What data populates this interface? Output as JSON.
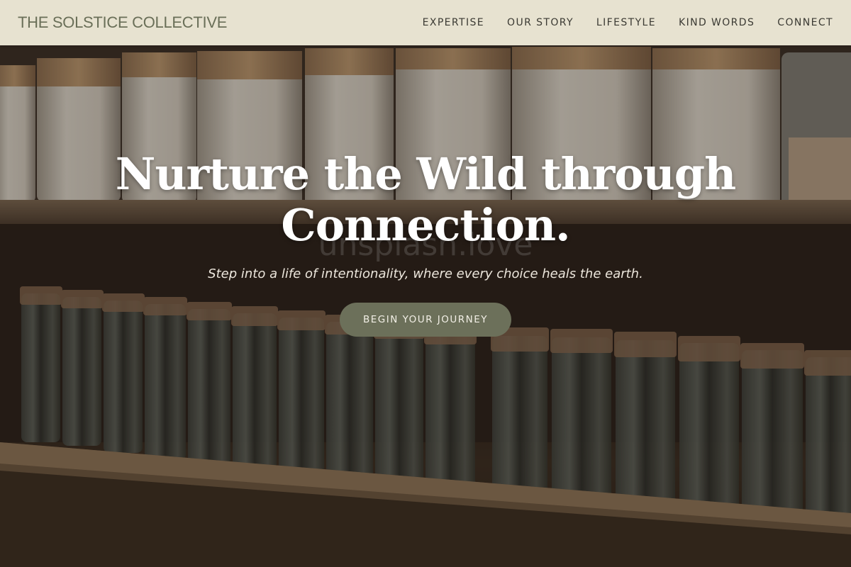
{
  "brand": {
    "name": "THE SOLSTICE COLLECTIVE"
  },
  "nav": {
    "items": [
      {
        "label": "EXPERTISE"
      },
      {
        "label": "OUR STORY"
      },
      {
        "label": "LIFESTYLE"
      },
      {
        "label": "KIND WORDS"
      },
      {
        "label": "CONNECT"
      }
    ]
  },
  "hero": {
    "title_line1": "Nurture the Wild through",
    "title_line2": "Connection.",
    "subtitle": "Step into a life of intentionality, where every choice heals the earth.",
    "cta_label": "BEGIN YOUR JOURNEY",
    "watermark": "unsplash.love",
    "background_image": "pantry-shelves-with-stoneware-crocks-and-glass-jars"
  },
  "colors": {
    "header_bg": "#e7e2d0",
    "brand_text": "#6a6f58",
    "cta_bg": "#6c705a"
  }
}
